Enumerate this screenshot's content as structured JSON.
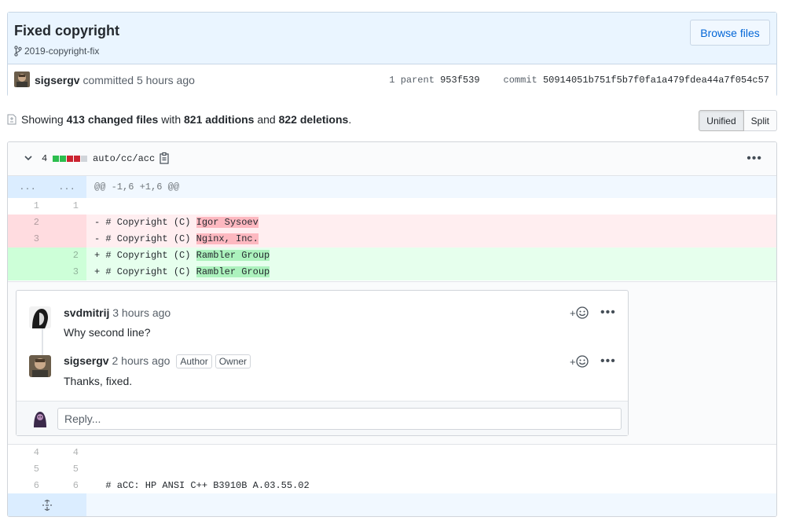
{
  "commit": {
    "title": "Fixed copyright",
    "branch": "2019-copyright-fix",
    "browse_label": "Browse files",
    "author": "sigsergv",
    "committed_text": "committed 5 hours ago",
    "parent_label": "1 parent",
    "parent_sha": "953f539",
    "commit_label": "commit",
    "commit_sha": "50914051b751f5b7f0fa1a479fdea44a7f054c57"
  },
  "summary": {
    "prefix": "Showing",
    "files": "413 changed files",
    "with": "with",
    "additions": "821 additions",
    "and": "and",
    "deletions": "822 deletions",
    "suffix": "."
  },
  "view_toggle": {
    "unified": "Unified",
    "split": "Split",
    "selected": "Unified"
  },
  "file": {
    "change_count": "4",
    "path": "auto/cc/acc",
    "hunk": {
      "n1": "...",
      "n2": "...",
      "text": "@@ -1,6 +1,6 @@"
    },
    "lines": {
      "l1": {
        "n1": "1",
        "n2": "1",
        "text": ""
      },
      "d2": {
        "n1": "2",
        "n2": "",
        "prefix": "- # Copyright (C) ",
        "changed": "Igor Sysoev"
      },
      "d3": {
        "n1": "3",
        "n2": "",
        "prefix": "- # Copyright (C) ",
        "changed": "Nginx, Inc."
      },
      "a2": {
        "n1": "",
        "n2": "2",
        "prefix": "+ # Copyright (C) ",
        "changed": "Rambler Group"
      },
      "a3": {
        "n1": "",
        "n2": "3",
        "prefix": "+ # Copyright (C) ",
        "changed": "Rambler Group"
      },
      "l4": {
        "n1": "4",
        "n2": "4",
        "text": ""
      },
      "l5": {
        "n1": "5",
        "n2": "5",
        "text": ""
      },
      "l6": {
        "n1": "6",
        "n2": "6",
        "text": "  # aCC: HP ANSI C++ B3910B A.03.55.02"
      }
    }
  },
  "comments": [
    {
      "author": "svdmitrij",
      "time": "3 hours ago",
      "body": "Why second line?"
    },
    {
      "author": "sigsergv",
      "time": "2 hours ago",
      "labels": [
        "Author",
        "Owner"
      ],
      "body": "Thanks, fixed."
    }
  ],
  "reply": {
    "placeholder": "Reply..."
  },
  "colors": {
    "accent": "#0366d6",
    "addition": "#2cbe4e",
    "deletion": "#cb2431",
    "header_bg": "#eaf5ff"
  }
}
